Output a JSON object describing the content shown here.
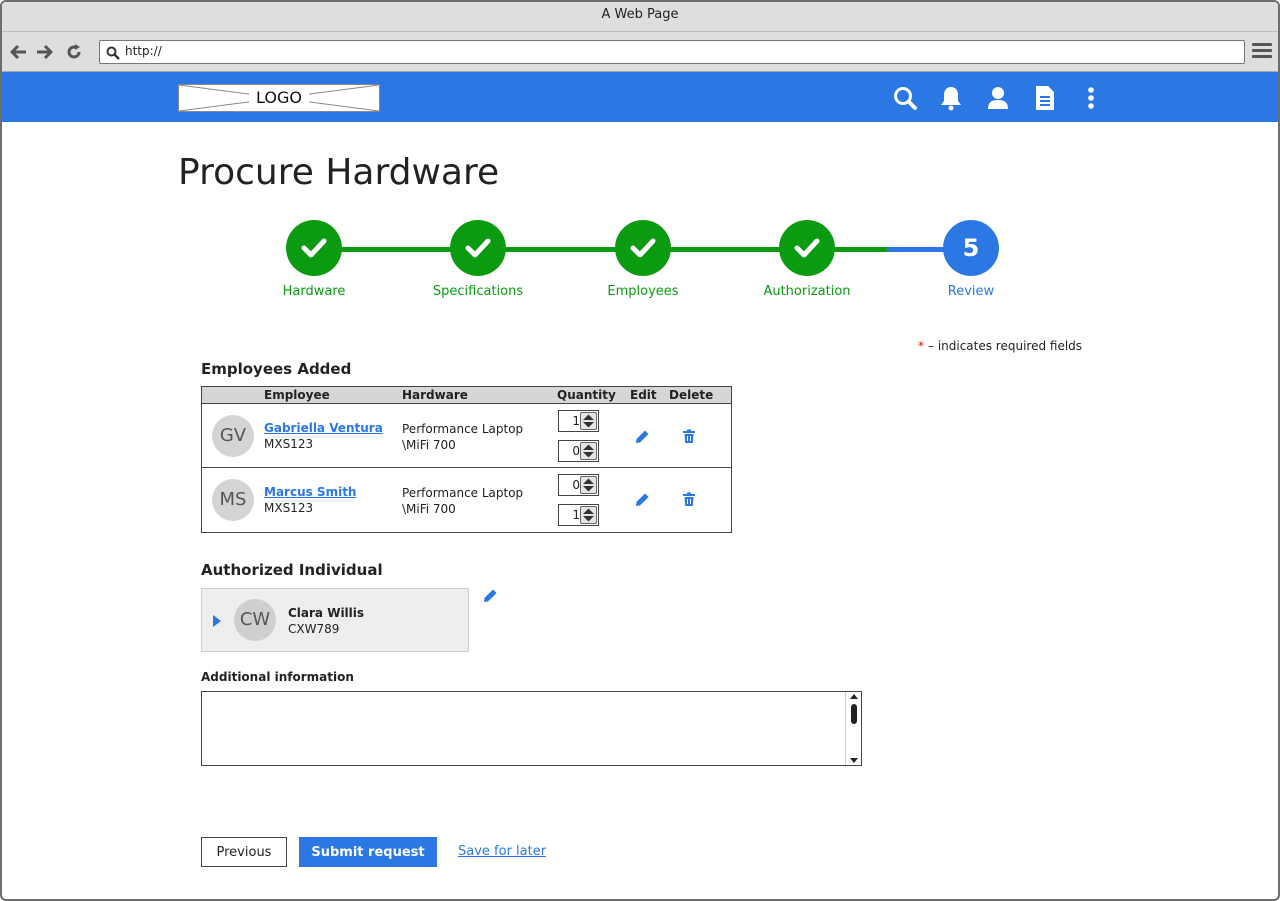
{
  "window": {
    "title": "A Web Page"
  },
  "browser": {
    "url": "http://"
  },
  "app": {
    "logo_text": "LOGO",
    "icons": [
      "search-icon",
      "bell-icon",
      "user-icon",
      "document-icon",
      "more-vertical-icon"
    ]
  },
  "page": {
    "title": "Procure Hardware"
  },
  "steps": [
    {
      "label": "Hardware",
      "state": "done"
    },
    {
      "label": "Specifications",
      "state": "done"
    },
    {
      "label": "Employees",
      "state": "done"
    },
    {
      "label": "Authorization",
      "state": "done"
    },
    {
      "label": "Review",
      "state": "current",
      "number": "5"
    }
  ],
  "required_note": {
    "star": "*",
    "text": "– indicates required fields"
  },
  "employees": {
    "heading": "Employees Added",
    "columns": {
      "employee": "Employee",
      "hardware": "Hardware",
      "quantity": "Quantity",
      "edit": "Edit",
      "delete": "Delete"
    },
    "rows": [
      {
        "initials": "GV",
        "name": "Gabriella Ventura",
        "id": "MXS123",
        "hardware_line1": "Performance Laptop",
        "hardware_line2": "\\MiFi 700",
        "qty1": "1",
        "qty2": "0"
      },
      {
        "initials": "MS",
        "name": "Marcus Smith",
        "id": "MXS123",
        "hardware_line1": "Performance Laptop",
        "hardware_line2": "\\MiFi 700",
        "qty1": "0",
        "qty2": "1"
      }
    ]
  },
  "authorized": {
    "heading": "Authorized Individual",
    "initials": "CW",
    "name": "Clara Willis",
    "id": "CXW789"
  },
  "additional": {
    "label": "Additional information",
    "value": ""
  },
  "actions": {
    "previous": "Previous",
    "submit": "Submit request",
    "save_later": "Save for later"
  },
  "colors": {
    "primary": "#2b78e4",
    "success": "#0a9b10",
    "required": "#dd0000"
  }
}
